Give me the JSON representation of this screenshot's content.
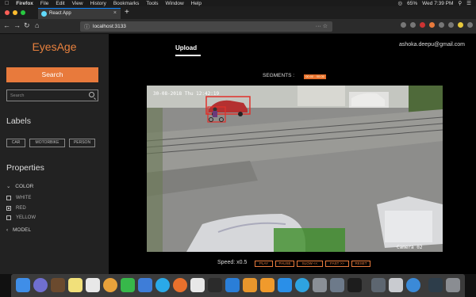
{
  "menubar": {
    "app": "Firefox",
    "items": [
      "File",
      "Edit",
      "View",
      "History",
      "Bookmarks",
      "Tools",
      "Window",
      "Help"
    ],
    "battery": "65%",
    "clock": "Wed 7:39 PM"
  },
  "browser": {
    "tab_title": "React App",
    "new_tab": "+",
    "url": "localhost:3133"
  },
  "app": {
    "logo": "EyesAge",
    "search_button": "Search",
    "search_placeholder": "Search",
    "labels_title": "Labels",
    "labels": [
      "CAR",
      "MOTORBIKE",
      "PERSON"
    ],
    "properties_title": "Properties",
    "color_group": "COLOR",
    "colors": [
      {
        "name": "WHITE",
        "checked": false
      },
      {
        "name": "RED",
        "checked": true
      },
      {
        "name": "YELLOW",
        "checked": false
      }
    ],
    "model_group": "MODEL",
    "upload_tab": "Upload",
    "user_email": "ashoka.deepu@gmail.com",
    "segments_label": "SEGMENTS :",
    "segment_chip": "00:00 - 00:05",
    "video": {
      "timestamp": "30-08-2018 Thu 12:42:19",
      "camera": "Camera 02",
      "detection_color": "#e0302a"
    },
    "speed_label": "Speed: x0.5",
    "controls": [
      "PLAY",
      "PAUSE",
      "SLOW <<",
      "FAST >>",
      "RESET"
    ]
  },
  "colors": {
    "accent": "#e87a3c",
    "sidebar_bg": "#222222",
    "main_bg": "#000000",
    "browser_accent": "#0a84ff"
  }
}
